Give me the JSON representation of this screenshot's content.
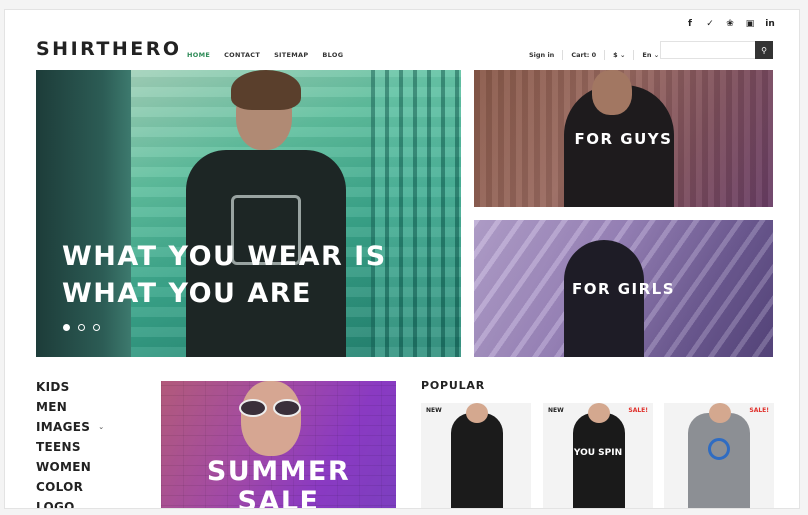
{
  "social": [
    {
      "icon": "facebook-icon",
      "glyph": "f"
    },
    {
      "icon": "twitter-icon",
      "glyph": "✓"
    },
    {
      "icon": "pinterest-icon",
      "glyph": "❀"
    },
    {
      "icon": "instagram-icon",
      "glyph": "▣"
    },
    {
      "icon": "linkedin-icon",
      "glyph": "in"
    }
  ],
  "header": {
    "logo": "SHIRTHERO",
    "nav": [
      "HOME",
      "CONTACT",
      "SITEMAP",
      "BLOG"
    ],
    "active_nav": "HOME",
    "sign_in": "Sign in",
    "cart": "Cart: 0",
    "currency": "$",
    "language": "En",
    "search_placeholder": "",
    "search_icon": "search-icon"
  },
  "hero": {
    "line1": "WHAT YOU WEAR IS",
    "line2": "WHAT YOU ARE",
    "slides": 3,
    "active_slide": 1
  },
  "banners": {
    "guys": "FOR GUYS",
    "girls": "FOR GIRLS"
  },
  "categories": [
    "KIDS",
    "MEN",
    "IMAGES",
    "TEENS",
    "WOMEN",
    "COLOR",
    "LOGO"
  ],
  "summer": {
    "line1": "SUMMER",
    "line2": "SALE"
  },
  "popular": {
    "title": "POPULAR",
    "products": [
      {
        "new": "NEW",
        "sale": "",
        "text": ""
      },
      {
        "new": "NEW",
        "sale": "SALE!",
        "text": "YOU SPIN"
      },
      {
        "new": "",
        "sale": "SALE!",
        "text": ""
      }
    ]
  },
  "colors": {
    "accent": "#2e8b57",
    "sale": "#e0302b"
  }
}
